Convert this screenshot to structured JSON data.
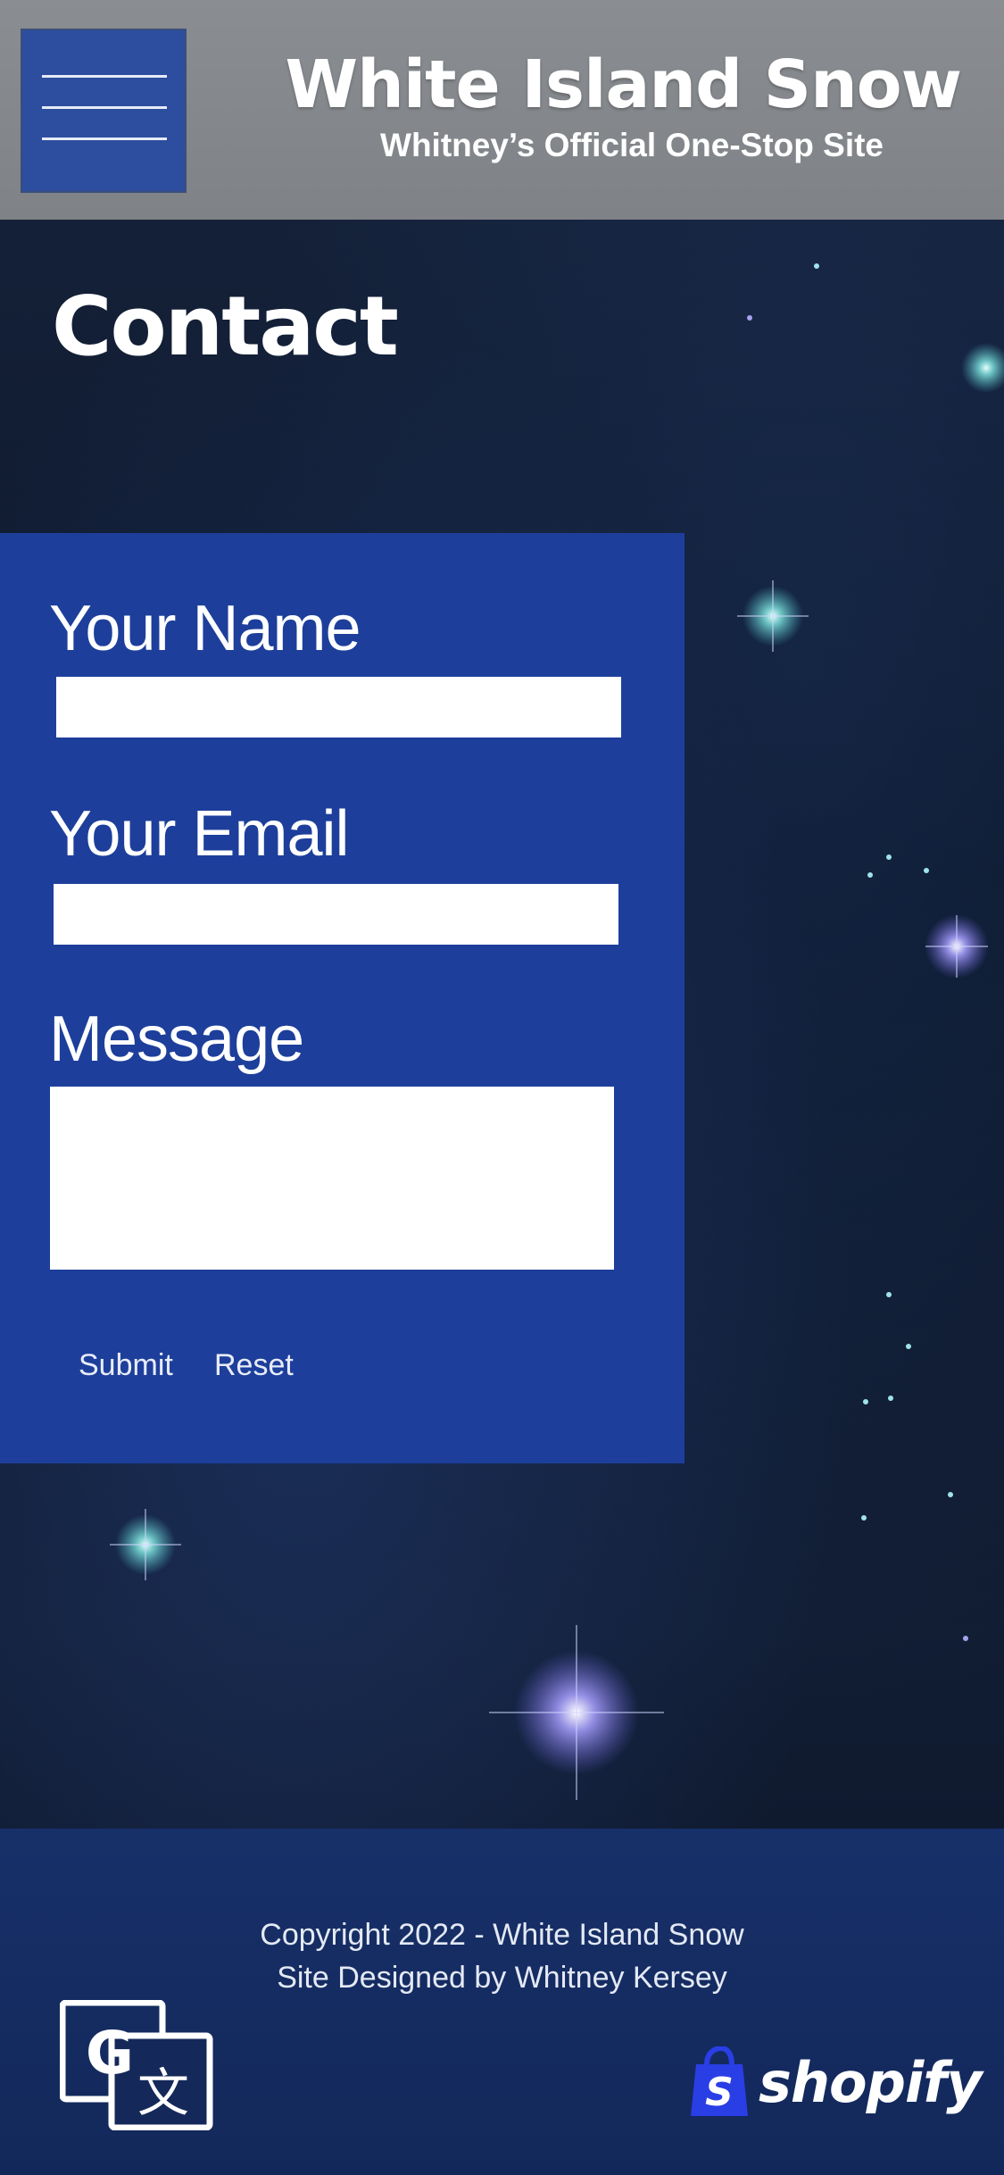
{
  "header": {
    "title": "White Island Snow",
    "subtitle": "Whitney’s Official One-Stop Site",
    "menu_icon": "hamburger-menu-icon"
  },
  "page": {
    "title": "Contact"
  },
  "form": {
    "name_label": "Your Name",
    "name_value": "",
    "email_label": "Your Email",
    "email_value": "",
    "message_label": "Message",
    "message_value": "",
    "submit_label": "Submit",
    "reset_label": "Reset"
  },
  "footer": {
    "copyright": "Copyright 2022 - White Island Snow",
    "credit": "Site Designed by Whitney Kersey",
    "translate_icon": "google-translate-icon",
    "shopify_label": "shopify"
  },
  "colors": {
    "header_bg": "#8a8d91",
    "menu_button_bg": "#2d4e9e",
    "form_panel_bg": "#1d3f9b",
    "footer_bg": "#173069",
    "page_bg": "#0f1a2e",
    "shopify_bag": "#2a3ee6"
  }
}
